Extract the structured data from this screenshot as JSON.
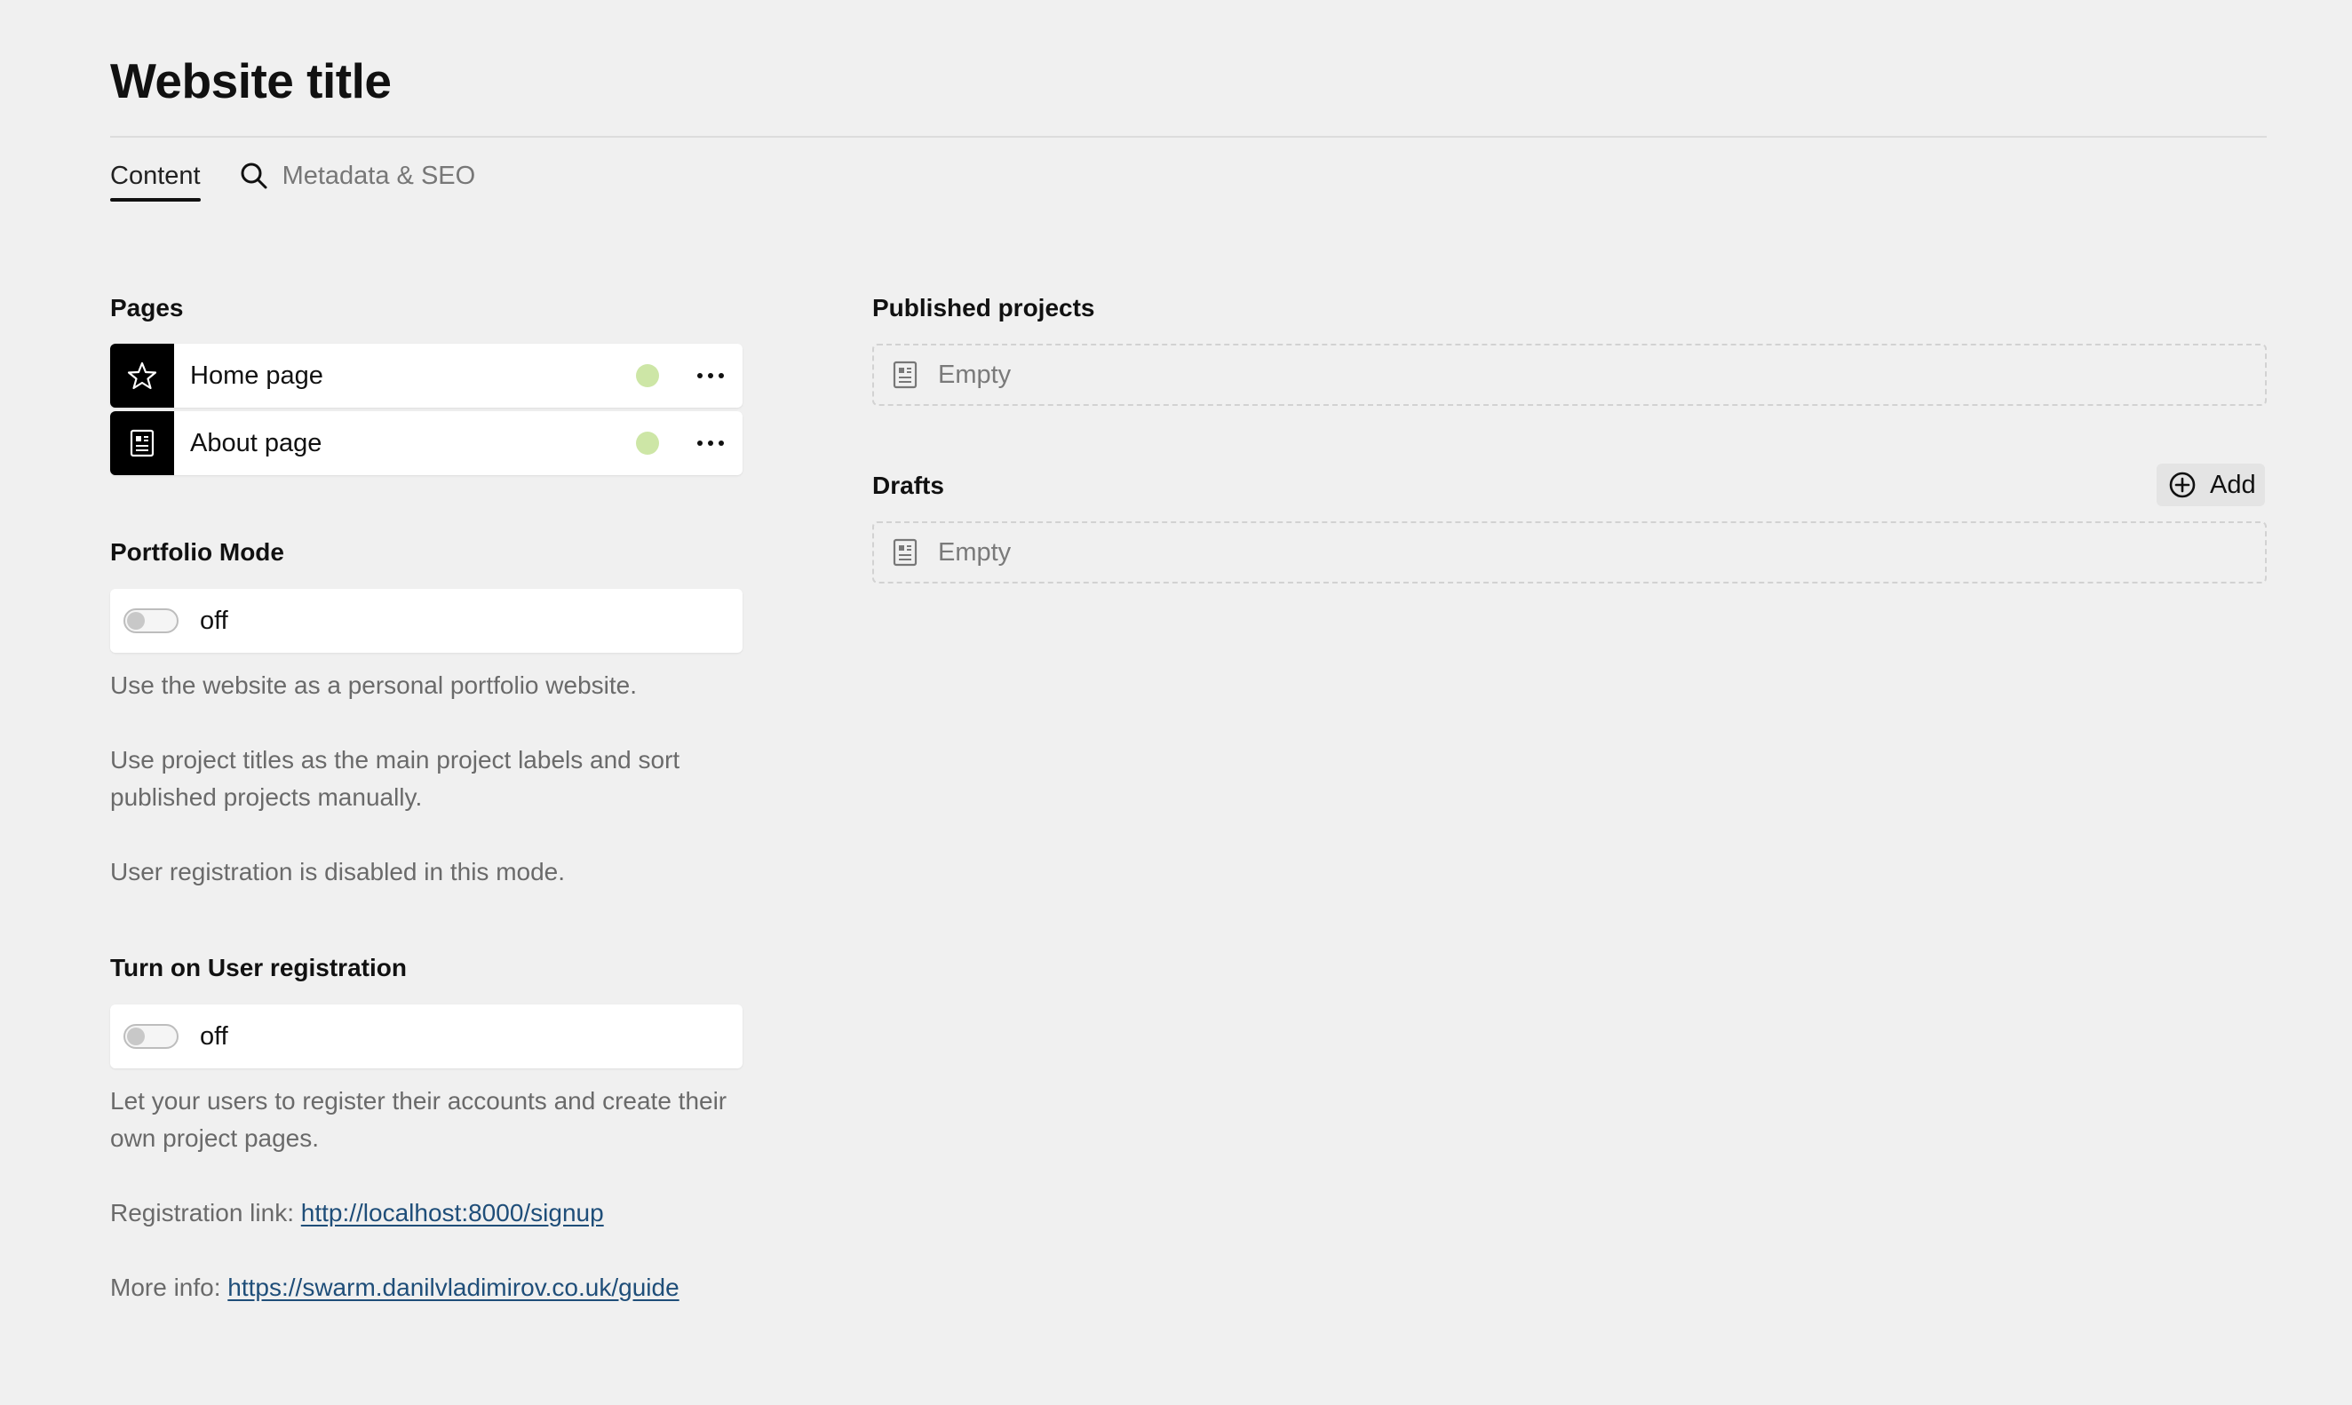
{
  "header": {
    "title": "Website title"
  },
  "tabs": [
    {
      "label": "Content",
      "icon": "none",
      "active": true
    },
    {
      "label": "Metadata & SEO",
      "icon": "search-icon",
      "active": false
    }
  ],
  "pages": {
    "label": "Pages",
    "items": [
      {
        "label": "Home page",
        "icon": "star-icon",
        "status_color": "#cde6a6"
      },
      {
        "label": "About page",
        "icon": "document-icon",
        "status_color": "#cde6a6"
      }
    ]
  },
  "portfolio_mode": {
    "label": "Portfolio Mode",
    "state": "off",
    "descriptions": [
      "Use the website as a personal portfolio website.",
      "Use project titles as the main project labels and sort published projects manually.",
      "User registration is disabled in this mode."
    ]
  },
  "user_registration": {
    "label": "Turn on User registration",
    "state": "off",
    "description": "Let your users to register their accounts and create their own project pages.",
    "registration_link_label": "Registration link: ",
    "registration_link": "http://localhost:8000/signup",
    "more_info_label": "More info: ",
    "more_info_link": "https://swarm.danilvladimirov.co.uk/guide"
  },
  "published_projects": {
    "label": "Published projects",
    "empty_text": "Empty"
  },
  "drafts": {
    "label": "Drafts",
    "add_label": "Add",
    "empty_text": "Empty"
  }
}
